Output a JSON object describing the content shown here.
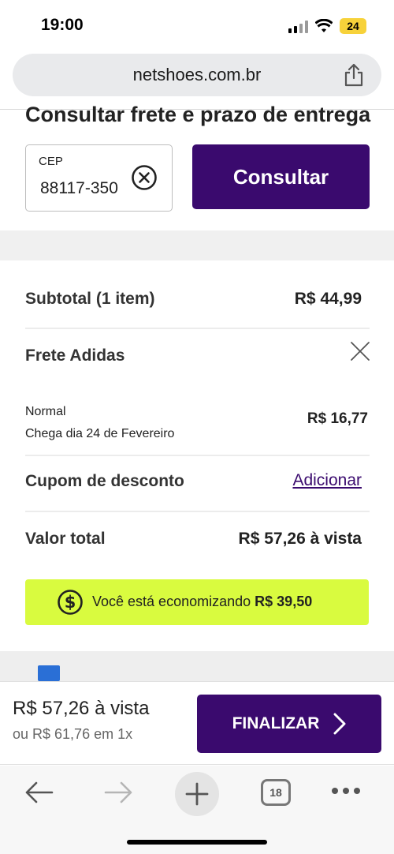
{
  "status_bar": {
    "time": "19:00",
    "battery": "24"
  },
  "browser": {
    "url": "netshoes.com.br",
    "tabs_count": "18"
  },
  "shipping": {
    "title": "Consultar frete e prazo de entrega",
    "cep_label": "CEP",
    "cep_value": "88117-350",
    "consult_button": "Consultar"
  },
  "summary": {
    "subtotal_label": "Subtotal (1 item)",
    "subtotal_value": "R$ 44,99",
    "freight_label": "Frete Adidas",
    "freight_type": "Normal",
    "freight_eta": "Chega dia 24 de Fevereiro",
    "freight_value": "R$ 16,77",
    "coupon_label": "Cupom de desconto",
    "coupon_action": "Adicionar",
    "total_label": "Valor total",
    "total_value": "R$ 57,26 à vista"
  },
  "savings": {
    "prefix": "Você está economizando",
    "amount": "R$ 39,50"
  },
  "bottom": {
    "price": "R$ 57,26 à vista",
    "installment": "ou R$ 61,76 em 1x",
    "finalize_button": "FINALIZAR"
  },
  "colors": {
    "primary": "#3a0a6e",
    "savings_bg": "#d9fb3f"
  }
}
